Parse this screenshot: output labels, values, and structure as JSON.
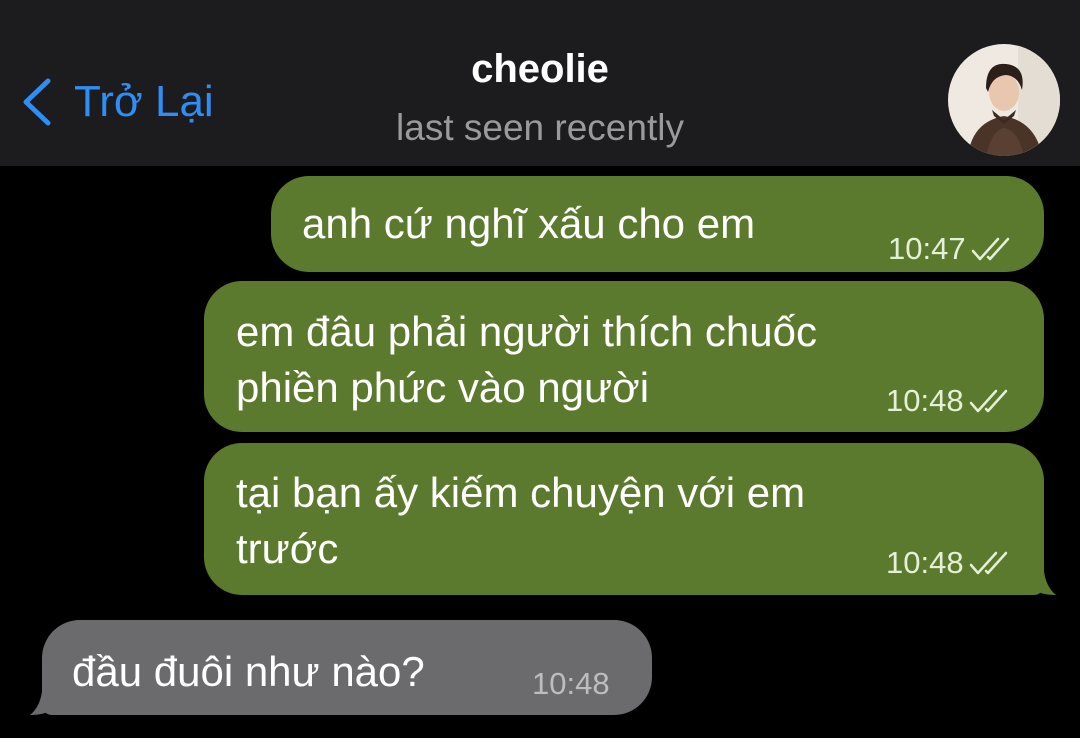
{
  "header": {
    "back_label": "Trở Lại",
    "chat_name": "cheolie",
    "status": "last seen recently"
  },
  "messages": [
    {
      "direction": "outgoing",
      "text": "anh cứ nghĩ xấu cho em",
      "time": "10:47",
      "read": true
    },
    {
      "direction": "outgoing",
      "text": "em đâu phải người thích chuốc\nphiền phức vào người",
      "time": "10:48",
      "read": true
    },
    {
      "direction": "outgoing",
      "text": "tại bạn ấy kiếm chuyện với em\ntrước",
      "time": "10:48",
      "read": true
    },
    {
      "direction": "incoming",
      "text": "đầu đuôi như nào?",
      "time": "10:48"
    }
  ],
  "colors": {
    "accent": "#2f8ef5",
    "outgoing_bubble": "#5b7a2e",
    "incoming_bubble": "#6b6b6d",
    "header_bg": "#1c1c1e",
    "chat_bg": "#000000"
  },
  "icons": {
    "back": "chevron-left-icon",
    "read_receipt": "double-check-icon"
  }
}
